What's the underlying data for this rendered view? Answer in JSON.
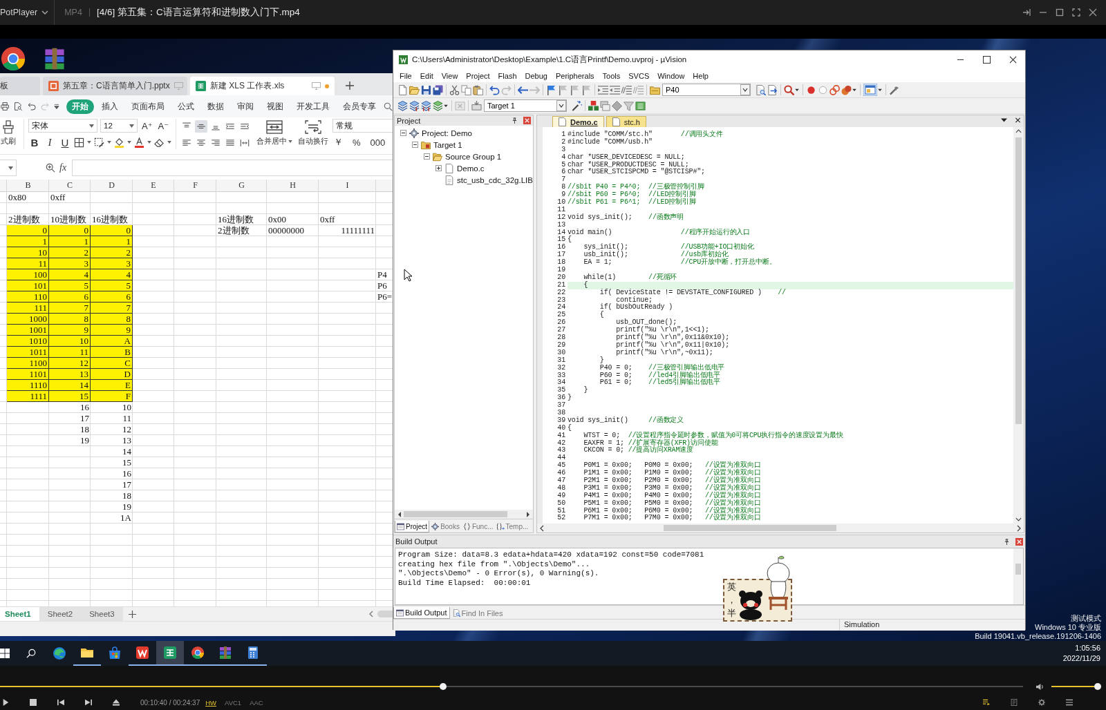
{
  "player": {
    "app_name": "PotPlayer",
    "format": "MP4",
    "title": "[4/6] 第五集：C语言运算符和进制数入门下.mp4",
    "seek": {
      "level": 0.433
    },
    "time": "00:10:40 / 00:24:37",
    "decoder": "HW",
    "video_codec": "AVC1",
    "audio_codec": "AAC",
    "volume": {
      "level": 1
    }
  },
  "spreadsheet": {
    "doc_tabs": [
      {
        "label": "板",
        "kind": "plain",
        "selected": false,
        "modified": false
      },
      {
        "label": "第五章：C语言简单入门.pptx",
        "kind": "presentation",
        "selected": false,
        "modified": false
      },
      {
        "label": "新建 XLS 工作表.xls",
        "kind": "sheet",
        "selected": true,
        "modified": true
      }
    ],
    "ribbon_tabs": [
      {
        "label": "开始",
        "selected": true
      },
      {
        "label": "插入",
        "selected": false
      },
      {
        "label": "页面布局",
        "selected": false
      },
      {
        "label": "公式",
        "selected": false
      },
      {
        "label": "数据",
        "selected": false
      },
      {
        "label": "审阅",
        "selected": false
      },
      {
        "label": "视图",
        "selected": false
      },
      {
        "label": "开发工具",
        "selected": false
      },
      {
        "label": "会员专享",
        "selected": false
      }
    ],
    "format_painter": "式刷",
    "font_name": "宋体",
    "font_size": "12",
    "font_size_buttons": [
      "A⁺",
      "A⁻"
    ],
    "style_buttons": [
      "B",
      "I",
      "U"
    ],
    "alignment_buttons": [
      {
        "selected": false
      },
      {
        "selected": true
      },
      {
        "selected": false
      },
      {
        "selected": false
      },
      {
        "selected": false
      },
      {
        "selected": false
      },
      {
        "selected": false
      },
      {
        "selected": false
      },
      {
        "selected": false
      },
      {
        "selected": false
      }
    ],
    "merge_label": "合并居中",
    "wrap_label": "自动换行",
    "number_format": "常规",
    "number_buttons": [
      "￥",
      "%",
      "000"
    ],
    "formula_label": "fx",
    "columns": [
      "B",
      "C",
      "D",
      "E",
      "F",
      "G",
      "H",
      "I"
    ],
    "rows": [
      {
        "highlighted": false,
        "cells": [
          {
            "text": "0x80",
            "kind": "text"
          },
          {
            "text": "0xff",
            "kind": "text"
          }
        ]
      },
      {
        "highlighted": false
      },
      {
        "highlighted": false,
        "cells": [
          {
            "text": "2进制数",
            "kind": "text"
          },
          {
            "text": "10进制数",
            "kind": "text"
          },
          {
            "text": "16进制数",
            "kind": "text"
          },
          null,
          null,
          {
            "text": "16进制数",
            "kind": "text"
          },
          {
            "text": "0x00",
            "kind": "text"
          },
          {
            "text": "0xff",
            "kind": "text"
          }
        ]
      },
      {
        "highlighted": true,
        "cells": [
          {
            "text": "0",
            "kind": "number"
          },
          {
            "text": "0",
            "kind": "number"
          },
          {
            "text": "0",
            "kind": "number"
          },
          null,
          null,
          {
            "text": "2进制数",
            "kind": "text"
          },
          {
            "text": "00000000",
            "kind": "text"
          },
          {
            "text": "11111111",
            "kind": "number"
          }
        ]
      },
      {
        "highlighted": true,
        "cells": [
          {
            "text": "1",
            "kind": "number"
          },
          {
            "text": "1",
            "kind": "number"
          },
          {
            "text": "1",
            "kind": "number"
          }
        ]
      },
      {
        "highlighted": true,
        "cells": [
          {
            "text": "10",
            "kind": "number"
          },
          {
            "text": "2",
            "kind": "number"
          },
          {
            "text": "2",
            "kind": "number"
          }
        ]
      },
      {
        "highlighted": true,
        "cells": [
          {
            "text": "11",
            "kind": "number"
          },
          {
            "text": "3",
            "kind": "number"
          },
          {
            "text": "3",
            "kind": "number"
          }
        ]
      },
      {
        "highlighted": true,
        "cells": [
          {
            "text": "100",
            "kind": "number"
          },
          {
            "text": "4",
            "kind": "number"
          },
          {
            "text": "4",
            "kind": "number"
          },
          null,
          null,
          null,
          null,
          null,
          {
            "text": "P4",
            "kind": "text"
          }
        ]
      },
      {
        "highlighted": true,
        "cells": [
          {
            "text": "101",
            "kind": "number"
          },
          {
            "text": "5",
            "kind": "number"
          },
          {
            "text": "5",
            "kind": "number"
          },
          null,
          null,
          null,
          null,
          null,
          {
            "text": "P6",
            "kind": "text"
          }
        ]
      },
      {
        "highlighted": true,
        "cells": [
          {
            "text": "110",
            "kind": "number"
          },
          {
            "text": "6",
            "kind": "number"
          },
          {
            "text": "6",
            "kind": "number"
          },
          null,
          null,
          null,
          null,
          null,
          {
            "text": "P6=",
            "kind": "text"
          }
        ]
      },
      {
        "highlighted": true,
        "cells": [
          {
            "text": "111",
            "kind": "number"
          },
          {
            "text": "7",
            "kind": "number"
          },
          {
            "text": "7",
            "kind": "number"
          }
        ]
      },
      {
        "highlighted": true,
        "cells": [
          {
            "text": "1000",
            "kind": "number"
          },
          {
            "text": "8",
            "kind": "number"
          },
          {
            "text": "8",
            "kind": "number"
          }
        ]
      },
      {
        "highlighted": true,
        "cells": [
          {
            "text": "1001",
            "kind": "number"
          },
          {
            "text": "9",
            "kind": "number"
          },
          {
            "text": "9",
            "kind": "number"
          }
        ]
      },
      {
        "highlighted": true,
        "cells": [
          {
            "text": "1010",
            "kind": "number"
          },
          {
            "text": "10",
            "kind": "number"
          },
          {
            "text": "A",
            "kind": "number"
          }
        ]
      },
      {
        "highlighted": true,
        "cells": [
          {
            "text": "1011",
            "kind": "number"
          },
          {
            "text": "11",
            "kind": "number"
          },
          {
            "text": "B",
            "kind": "number"
          }
        ]
      },
      {
        "highlighted": true,
        "cells": [
          {
            "text": "1100",
            "kind": "number"
          },
          {
            "text": "12",
            "kind": "number"
          },
          {
            "text": "C",
            "kind": "number"
          }
        ]
      },
      {
        "highlighted": true,
        "cells": [
          {
            "text": "1101",
            "kind": "number"
          },
          {
            "text": "13",
            "kind": "number"
          },
          {
            "text": "D",
            "kind": "number"
          }
        ]
      },
      {
        "highlighted": true,
        "cells": [
          {
            "text": "1110",
            "kind": "number"
          },
          {
            "text": "14",
            "kind": "number"
          },
          {
            "text": "E",
            "kind": "number"
          }
        ]
      },
      {
        "highlighted": true,
        "cells": [
          {
            "text": "1111",
            "kind": "number"
          },
          {
            "text": "15",
            "kind": "number"
          },
          {
            "text": "F",
            "kind": "number"
          }
        ]
      },
      {
        "highlighted": false,
        "cells": [
          null,
          {
            "text": "16",
            "kind": "number"
          },
          {
            "text": "10",
            "kind": "number"
          }
        ]
      },
      {
        "highlighted": false,
        "cells": [
          null,
          {
            "text": "17",
            "kind": "number"
          },
          {
            "text": "11",
            "kind": "number"
          }
        ]
      },
      {
        "highlighted": false,
        "cells": [
          null,
          {
            "text": "18",
            "kind": "number"
          },
          {
            "text": "12",
            "kind": "number"
          }
        ]
      },
      {
        "highlighted": false,
        "cells": [
          null,
          {
            "text": "19",
            "kind": "number"
          },
          {
            "text": "13",
            "kind": "number"
          }
        ]
      },
      {
        "highlighted": false,
        "cells": [
          null,
          null,
          {
            "text": "14",
            "kind": "number"
          }
        ]
      },
      {
        "highlighted": false,
        "cells": [
          null,
          null,
          {
            "text": "15",
            "kind": "number"
          }
        ]
      },
      {
        "highlighted": false,
        "cells": [
          null,
          null,
          {
            "text": "16",
            "kind": "number"
          }
        ]
      },
      {
        "highlighted": false,
        "cells": [
          null,
          null,
          {
            "text": "17",
            "kind": "number"
          }
        ]
      },
      {
        "highlighted": false,
        "cells": [
          null,
          null,
          {
            "text": "18",
            "kind": "number"
          }
        ]
      },
      {
        "highlighted": false,
        "cells": [
          null,
          null,
          {
            "text": "19",
            "kind": "number"
          }
        ]
      },
      {
        "highlighted": false,
        "cells": [
          null,
          null,
          {
            "text": "1A",
            "kind": "number"
          }
        ]
      }
    ],
    "sheets": [
      {
        "label": "Sheet1",
        "selected": true
      },
      {
        "label": "Sheet2",
        "selected": false
      },
      {
        "label": "Sheet3",
        "selected": false
      }
    ]
  },
  "uvision": {
    "title": "C:\\Users\\Administrator\\Desktop\\Example\\1.C语言Printf\\Demo.uvproj - µVision",
    "menu": [
      "File",
      "Edit",
      "View",
      "Project",
      "Flash",
      "Debug",
      "Peripherals",
      "Tools",
      "SVCS",
      "Window",
      "Help"
    ],
    "find_combo": "P40",
    "target_combo": "Target 1",
    "project_panel": {
      "title": "Project",
      "tree": [
        {
          "label": "Project: Demo",
          "kind": "project",
          "expanded": true,
          "children": [
            {
              "label": "Target 1",
              "kind": "target",
              "expanded": true,
              "children": [
                {
                  "label": "Source Group 1",
                  "kind": "group",
                  "expanded": true,
                  "children": [
                    {
                      "label": "Demo.c",
                      "kind": "file",
                      "expanded": false
                    },
                    {
                      "label": "stc_usb_cdc_32g.LIB",
                      "kind": "library"
                    }
                  ]
                }
              ]
            }
          ]
        }
      ],
      "tabs": [
        {
          "label": "Project",
          "kind": "project",
          "selected": true
        },
        {
          "label": "Books",
          "kind": "books",
          "selected": false
        },
        {
          "label": "Func...",
          "kind": "functions",
          "selected": false
        },
        {
          "label": "Temp...",
          "kind": "templates",
          "selected": false
        }
      ]
    },
    "editor": {
      "tabs": [
        {
          "label": "Demo.c",
          "selected": true
        },
        {
          "label": "stc.h",
          "selected": false
        }
      ],
      "lines": [
        {
          "number": "1",
          "code": "#include \"COMM/stc.h\"       ",
          "comment": "//调用头文件",
          "current": false
        },
        {
          "number": "2",
          "code": "#include \"COMM/usb.h\"",
          "current": false
        },
        {
          "number": "3",
          "current": false
        },
        {
          "number": "4",
          "code": "char *USER_DEVICEDESC = NULL;",
          "current": false
        },
        {
          "number": "5",
          "code": "char *USER_PRODUCTDESC = NULL;",
          "current": false
        },
        {
          "number": "6",
          "code": "char *USER_STCISPCMD = \"@STCISP#\";",
          "current": false
        },
        {
          "number": "7",
          "current": false
        },
        {
          "number": "8",
          "comment": "//sbit P40 = P4^0;  //三极管控制引脚",
          "current": false
        },
        {
          "number": "9",
          "comment": "//sbit P60 = P6^0;  //LED控制引脚",
          "current": false
        },
        {
          "number": "10",
          "comment": "//sbit P61 = P6^1;  //LED控制引脚",
          "current": false
        },
        {
          "number": "11",
          "current": false
        },
        {
          "number": "12",
          "code": "void sys_init();    ",
          "comment": "//函数声明",
          "current": false
        },
        {
          "number": "13",
          "current": false
        },
        {
          "number": "14",
          "code": "void main()                 ",
          "comment": "//程序开始运行的入口",
          "current": false
        },
        {
          "number": "15",
          "code": "{",
          "current": false
        },
        {
          "number": "16",
          "code": "    sys_init();             ",
          "comment": "//USB功能+IO口初始化",
          "current": false
        },
        {
          "number": "17",
          "code": "    usb_init();             ",
          "comment": "//usb库初始化",
          "current": false
        },
        {
          "number": "18",
          "code": "    EA = 1;                 ",
          "comment": "//CPU开放中断，打开总中断。",
          "current": false
        },
        {
          "number": "19",
          "current": false
        },
        {
          "number": "20",
          "code": "    while(1)        ",
          "comment": "//死循环",
          "current": false
        },
        {
          "number": "21",
          "code": "    {",
          "current": true
        },
        {
          "number": "22",
          "code": "        if( DeviceState != DEVSTATE_CONFIGURED )    ",
          "comment": "//",
          "current": false
        },
        {
          "number": "23",
          "code": "            continue;",
          "current": false
        },
        {
          "number": "24",
          "code": "        if( bUsbOutReady )",
          "current": false
        },
        {
          "number": "25",
          "code": "        {",
          "current": false
        },
        {
          "number": "26",
          "code": "            usb_OUT_done();",
          "current": false
        },
        {
          "number": "27",
          "code": "            printf(\"%u \\r\\n\",1<<1);",
          "current": false
        },
        {
          "number": "28",
          "code": "            printf(\"%u \\r\\n\",0x11&0x10);",
          "current": false
        },
        {
          "number": "29",
          "code": "            printf(\"%u \\r\\n\",0x11|0x10);",
          "current": false
        },
        {
          "number": "30",
          "code": "            printf(\"%u \\r\\n\",~0x11);",
          "current": false
        },
        {
          "number": "31",
          "code": "        }",
          "current": false
        },
        {
          "number": "32",
          "code": "        P40 = 0;    ",
          "comment": "//三极管引脚输出低电平",
          "current": false
        },
        {
          "number": "33",
          "code": "        P60 = 0;    ",
          "comment": "//led4引脚输出低电平",
          "current": false
        },
        {
          "number": "34",
          "code": "        P61 = 0;    ",
          "comment": "//led5引脚输出低电平",
          "current": false
        },
        {
          "number": "35",
          "code": "    }",
          "current": false
        },
        {
          "number": "36",
          "code": "}",
          "current": false
        },
        {
          "number": "37",
          "current": false
        },
        {
          "number": "38",
          "current": false
        },
        {
          "number": "39",
          "code": "void sys_init()     ",
          "comment": "//函数定义",
          "current": false
        },
        {
          "number": "40",
          "code": "{",
          "current": false
        },
        {
          "number": "41",
          "code": "    WTST = 0;  ",
          "comment": "//设置程序指令延时参数，赋值为0可将CPU执行指令的速度设置为最快",
          "current": false
        },
        {
          "number": "42",
          "code": "    EAXFR = 1; ",
          "comment": "//扩展寄存器(XFR)访问使能",
          "current": false
        },
        {
          "number": "43",
          "code": "    CKCON = 0; ",
          "comment": "//提高访问XRAM速度",
          "current": false
        },
        {
          "number": "44",
          "current": false
        },
        {
          "number": "45",
          "code": "    P0M1 = 0x00;   P0M0 = 0x00;   ",
          "comment": "//设置为准双向口",
          "current": false
        },
        {
          "number": "46",
          "code": "    P1M1 = 0x00;   P1M0 = 0x00;   ",
          "comment": "//设置为准双向口",
          "current": false
        },
        {
          "number": "47",
          "code": "    P2M1 = 0x00;   P2M0 = 0x00;   ",
          "comment": "//设置为准双向口",
          "current": false
        },
        {
          "number": "48",
          "code": "    P3M1 = 0x00;   P3M0 = 0x00;   ",
          "comment": "//设置为准双向口",
          "current": false
        },
        {
          "number": "49",
          "code": "    P4M1 = 0x00;   P4M0 = 0x00;   ",
          "comment": "//设置为准双向口",
          "current": false
        },
        {
          "number": "50",
          "code": "    P5M1 = 0x00;   P5M0 = 0x00;   ",
          "comment": "//设置为准双向口",
          "current": false
        },
        {
          "number": "51",
          "code": "    P6M1 = 0x00;   P6M0 = 0x00;   ",
          "comment": "//设置为准双向口",
          "current": false
        },
        {
          "number": "52",
          "code": "    P7M1 = 0x00;   P7M0 = 0x00;   ",
          "comment": "//设置为准双向口",
          "current": false
        }
      ]
    },
    "build_output": {
      "title": "Build Output",
      "lines": [
        "Program Size: data=8.3 edata+hdata=420 xdata=192 const=50 code=7081",
        "creating hex file from \".\\Objects\\Demo\"...",
        "\".\\Objects\\Demo\" - 0 Error(s), 0 Warning(s).",
        "Build Time Elapsed:  00:00:01"
      ],
      "tabs": [
        {
          "label": "Build Output",
          "kind": "output",
          "selected": true
        },
        {
          "label": "Find In Files",
          "kind": "find",
          "selected": false
        }
      ]
    },
    "status": "Simulation"
  },
  "ime": {
    "mode": "英",
    "punctuation": "，",
    "width": "半"
  },
  "desktop_notice": [
    "测试模式",
    "Windows 10 专业版",
    "Build 19041.vb_release.191206-1406"
  ],
  "taskbar": {
    "apps": [
      {
        "running": false,
        "selected": false
      },
      {
        "running": true,
        "selected": false
      },
      {
        "running": false,
        "selected": false
      },
      {
        "running": true,
        "selected": false
      },
      {
        "running": true,
        "selected": true
      },
      {
        "running": true,
        "selected": false
      },
      {
        "running": true,
        "selected": false
      },
      {
        "running": true,
        "selected": false
      }
    ],
    "time": "1:05:56",
    "date": "2022/11/29"
  }
}
